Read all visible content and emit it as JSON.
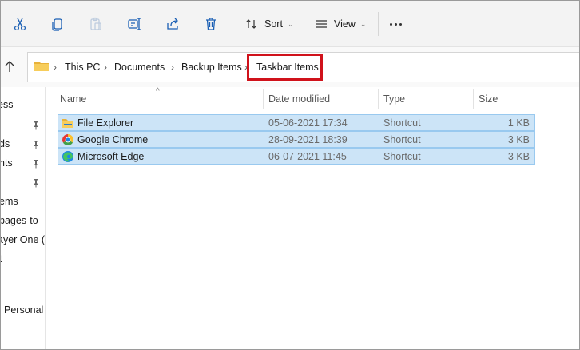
{
  "toolbar": {
    "cut_icon": "scissors-icon",
    "copy_icon": "copy-icon",
    "paste_icon": "paste-icon",
    "rename_icon": "rename-icon",
    "share_icon": "share-icon",
    "delete_icon": "trash-icon",
    "sort_label": "Sort",
    "view_label": "View",
    "more_icon": "ellipsis-icon"
  },
  "address": {
    "breadcrumbs": [
      "This PC",
      "Documents",
      "Backup Items",
      "Taskbar Items"
    ],
    "highlight_color": "#d0121b"
  },
  "nav": {
    "items": [
      "ess",
      "ds",
      "nts",
      "ems",
      "pages-to-",
      "ayer One (",
      "t",
      "Personal"
    ]
  },
  "columns": [
    "Name",
    "Date modified",
    "Type",
    "Size"
  ],
  "files": [
    {
      "name": "File Explorer",
      "date": "05-06-2021 17:34",
      "type": "Shortcut",
      "size": "1 KB",
      "icon": "file-explorer-icon"
    },
    {
      "name": "Google Chrome",
      "date": "28-09-2021 18:39",
      "type": "Shortcut",
      "size": "3 KB",
      "icon": "chrome-icon"
    },
    {
      "name": "Microsoft Edge",
      "date": "06-07-2021 11:45",
      "type": "Shortcut",
      "size": "3 KB",
      "icon": "edge-icon"
    }
  ],
  "colors": {
    "selection": "#cce4f7",
    "selection_border": "#99c9ef",
    "accent": "#1a5fb4"
  }
}
